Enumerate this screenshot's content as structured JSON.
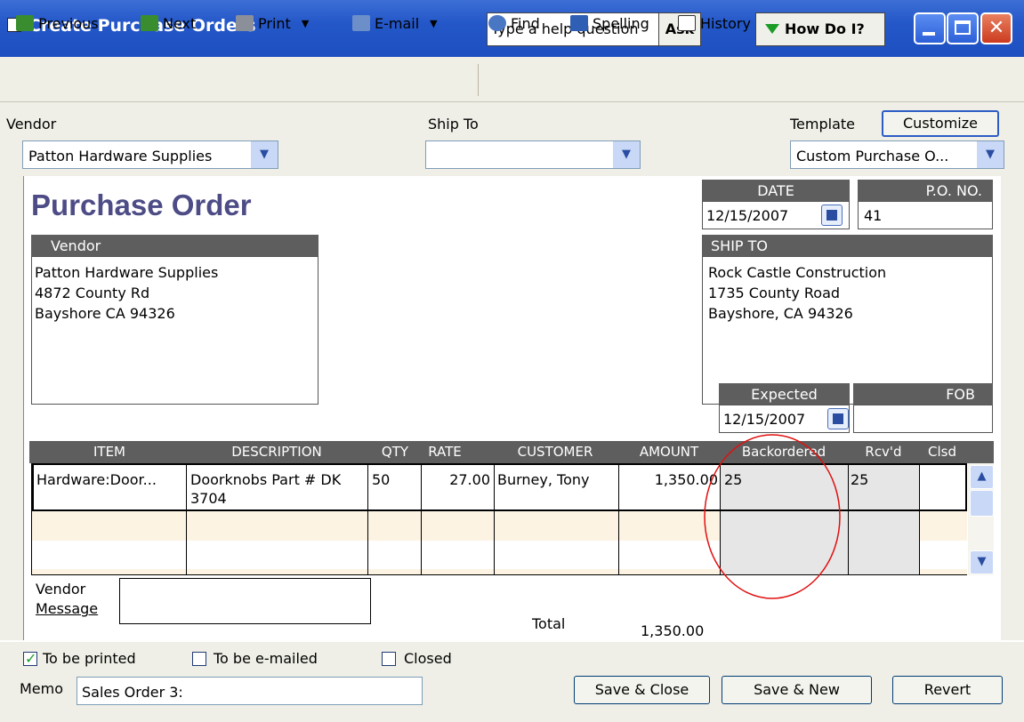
{
  "window": {
    "title": "Create Purchase Orders"
  },
  "help": {
    "question_text": "Type a help question",
    "ask_label": "Ask",
    "how_do_i_label": "How Do I?"
  },
  "toolbar": {
    "previous": "Previous",
    "next": "Next",
    "print": "Print",
    "email": "E-mail",
    "find": "Find",
    "spelling": "Spelling",
    "history": "History"
  },
  "header": {
    "vendor_label": "Vendor",
    "vendor_value": "Patton Hardware Supplies",
    "ship_to_label": "Ship To",
    "ship_to_value": "",
    "template_label": "Template",
    "template_value": "Custom Purchase O...",
    "customize_label": "Customize"
  },
  "form": {
    "title": "Purchase Order",
    "date_label": "DATE",
    "date_value": "12/15/2007",
    "po_no_label": "P.O. NO.",
    "po_no_value": "41",
    "vendor_box_label": "Vendor",
    "vendor_address": [
      "Patton Hardware Supplies",
      "4872 County Rd",
      "Bayshore CA 94326"
    ],
    "ship_to_box_label": "SHIP TO",
    "ship_to_address": [
      "Rock Castle Construction",
      "1735 County Road",
      "Bayshore, CA 94326"
    ],
    "expected_label": "Expected",
    "expected_value": "12/15/2007",
    "fob_label": "FOB",
    "fob_value": ""
  },
  "table": {
    "columns": [
      "ITEM",
      "DESCRIPTION",
      "QTY",
      "RATE",
      "CUSTOMER",
      "AMOUNT",
      "Backordered",
      "Rcv'd",
      "Clsd"
    ],
    "rows": [
      {
        "item": "Hardware:Door...",
        "description_line1": "Doorknobs Part # DK",
        "description_line2": "3704",
        "qty": "50",
        "rate": "27.00",
        "customer": "Burney, Tony",
        "amount": "1,350.00",
        "backordered": "25",
        "rcvd": "25",
        "clsd": ""
      }
    ]
  },
  "footer": {
    "vendor_message_line1": "Vendor",
    "vendor_message_line2": "Message",
    "total_label": "Total",
    "total_value": "1,350.00",
    "to_be_printed_label": "To be printed",
    "to_be_printed_checked": true,
    "to_be_emailed_label": "To be e-mailed",
    "to_be_emailed_checked": false,
    "closed_label": "Closed",
    "closed_checked": false,
    "memo_label": "Memo",
    "memo_value": "Sales Order 3:",
    "save_close_label": "Save & Close",
    "save_new_label": "Save & New",
    "revert_label": "Revert"
  },
  "colors": {
    "titlebar": "#2457c8",
    "form_title": "#4d4c86",
    "header_fill": "#5e5e5e",
    "annotation_circle": "#e01010",
    "new_row": "#fdf3e3"
  }
}
